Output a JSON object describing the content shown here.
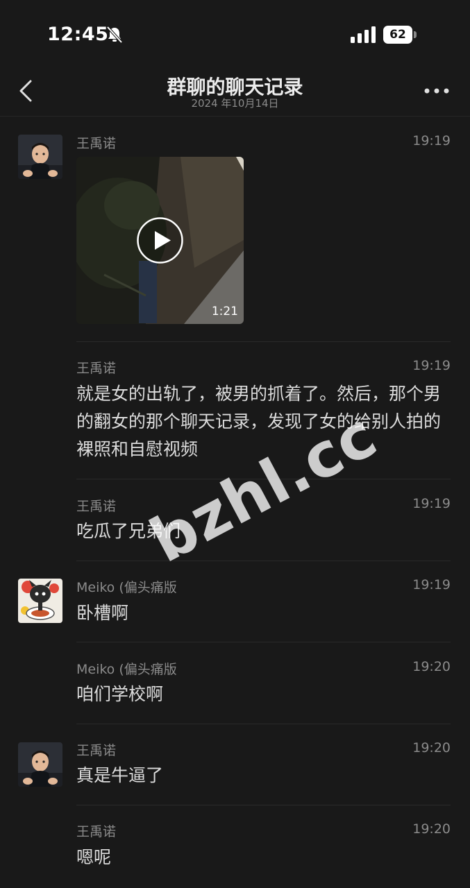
{
  "status_bar": {
    "time": "12:45",
    "battery": "62"
  },
  "header": {
    "title": "群聊的聊天记录",
    "date": "2024 年10月14日"
  },
  "messages": [
    {
      "sender": "王禹诺",
      "time": "19:19",
      "type": "video",
      "duration": "1:21"
    },
    {
      "sender": "王禹诺",
      "time": "19:19",
      "text": "就是女的出轨了，被男的抓着了。然后，那个男的翻女的那个聊天记录，发现了女的给别人拍的裸照和自慰视频"
    },
    {
      "sender": "王禹诺",
      "time": "19:19",
      "text": "吃瓜了兄弟们"
    },
    {
      "sender": "Meiko (偏头痛版",
      "time": "19:19",
      "text": "卧槽啊"
    },
    {
      "sender": "Meiko (偏头痛版",
      "time": "19:20",
      "text": "咱们学校啊"
    },
    {
      "sender": "王禹诺",
      "time": "19:20",
      "text": "真是牛逼了"
    },
    {
      "sender": "王禹诺",
      "time": "19:20",
      "text": "嗯呢"
    }
  ],
  "watermark": "bzhl.cc",
  "icons": [
    "bell-slash-icon",
    "signal-icon",
    "battery-icon",
    "back-arrow-icon",
    "more-icon",
    "play-icon"
  ]
}
